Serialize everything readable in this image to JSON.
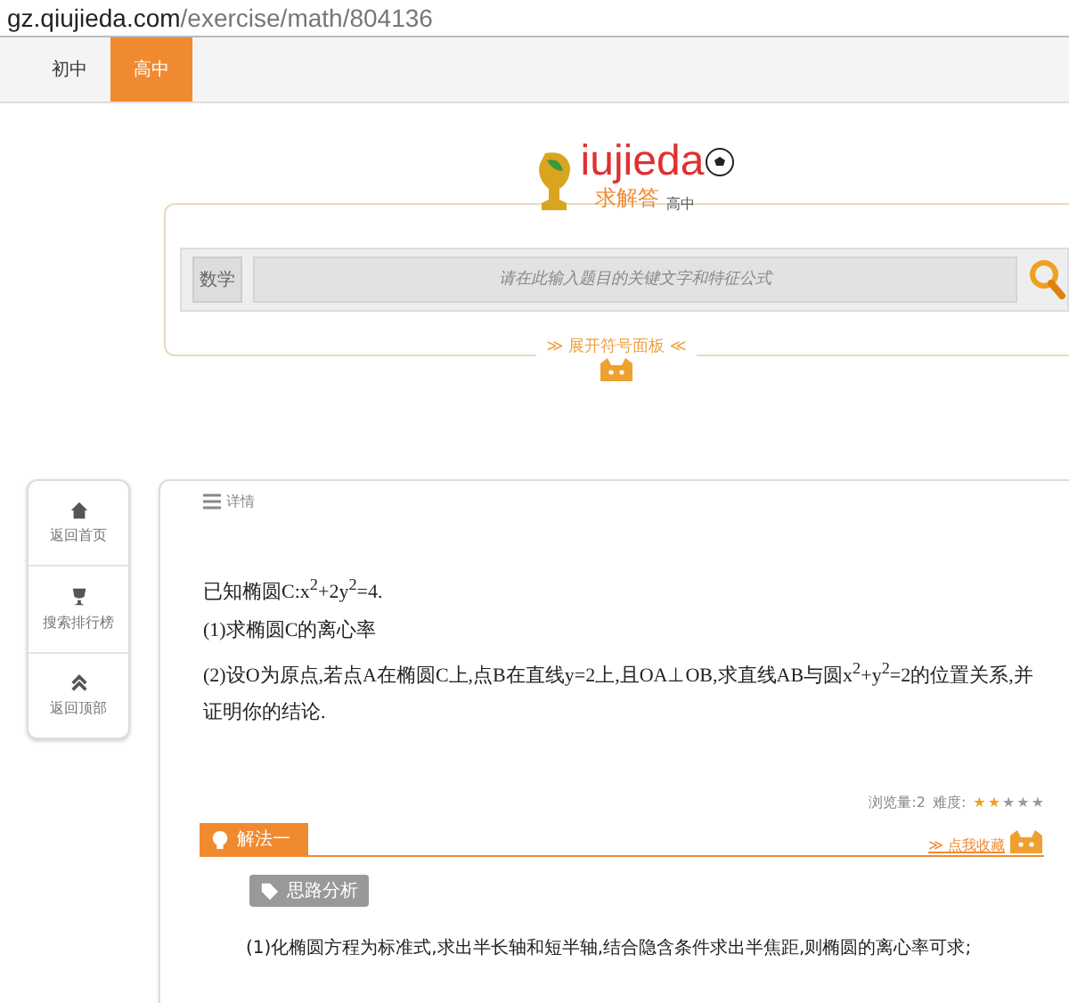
{
  "address_bar": {
    "domain": "gz.qiujieda.com",
    "path": "/exercise/math/804136"
  },
  "tabs": [
    {
      "label": "初中",
      "selected": false
    },
    {
      "label": "高中",
      "selected": true
    }
  ],
  "logo": {
    "wordmark": "iujieda",
    "chinese": "求解答",
    "level": "高中"
  },
  "search": {
    "subject": "数学",
    "placeholder": "请在此输入题目的关键文字和特征公式"
  },
  "symbol_panel": {
    "left_mark": "≫",
    "label": "展开符号面板",
    "right_mark": "≪"
  },
  "sidebar": {
    "items": [
      {
        "label": "返回首页"
      },
      {
        "label": "搜索排行榜"
      },
      {
        "label": "返回顶部"
      }
    ]
  },
  "detail": {
    "header": "详情",
    "question": [
      "已知椭圆C:x$^{2}$+2y$^{2}$=4.",
      "(1)求椭圆C的离心率",
      "(2)设O为原点,若点A在椭圆C上,点B在直线y=2上,且OA⊥OB,求直线AB与圆x$^{2}$+y$^{2}$=2的位置关系,并证明你的结论."
    ],
    "views_label": "浏览量:2",
    "difficulty_label": "难度:",
    "stars": 2,
    "solution_tab": "解法一",
    "favorite_mark": "≫",
    "favorite": "点我收藏",
    "analysis_tag": "思路分析",
    "analysis_text": "(1)化椭圆方程为标准式,求出半长轴和短半轴,结合隐含条件求出半焦距,则椭圆的离心率可求;"
  }
}
